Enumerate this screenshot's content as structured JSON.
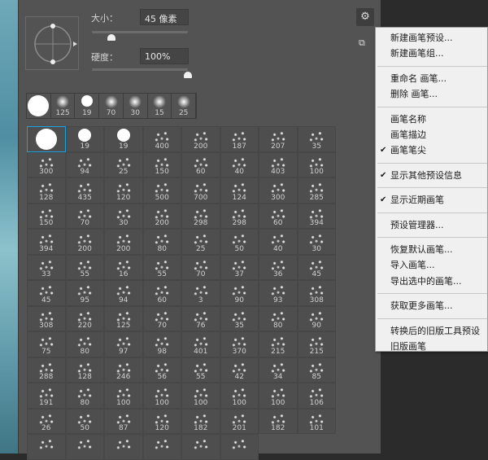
{
  "size": {
    "label": "大小：",
    "value": "45 像素",
    "slider_percent": 20
  },
  "hardness": {
    "label": "硬度：",
    "value": "100%",
    "slider_percent": 100
  },
  "recent": [
    {
      "n": "",
      "hard": true
    },
    {
      "n": "125"
    },
    {
      "n": "19",
      "hard": true
    },
    {
      "n": "70"
    },
    {
      "n": "30"
    },
    {
      "n": "15"
    },
    {
      "n": "25"
    }
  ],
  "presets": [
    "",
    "19",
    "19",
    "400",
    "200",
    "187",
    "207",
    "35",
    "300",
    "94",
    "25",
    "150",
    "60",
    "40",
    "403",
    "100",
    "128",
    "435",
    "120",
    "500",
    "700",
    "124",
    "300",
    "285",
    "150",
    "70",
    "30",
    "200",
    "298",
    "298",
    "60",
    "394",
    "394",
    "200",
    "200",
    "80",
    "25",
    "50",
    "40",
    "30",
    "33",
    "55",
    "16",
    "55",
    "70",
    "37",
    "36",
    "45",
    "45",
    "95",
    "94",
    "60",
    "3",
    "90",
    "93",
    "308",
    "308",
    "220",
    "125",
    "70",
    "76",
    "35",
    "80",
    "90",
    "75",
    "80",
    "97",
    "98",
    "401",
    "370",
    "215",
    "215",
    "288",
    "128",
    "246",
    "56",
    "55",
    "42",
    "34",
    "85",
    "191",
    "80",
    "100",
    "100",
    "100",
    "100",
    "100",
    "106",
    "26",
    "50",
    "87",
    "120",
    "182",
    "201",
    "182",
    "101",
    "",
    "",
    "",
    "",
    "",
    ""
  ],
  "gear_icon": "gear-icon",
  "menu": [
    {
      "label": "新建画笔预设...",
      "checked": false
    },
    {
      "label": "新建画笔组...",
      "checked": false
    },
    {
      "sep": true
    },
    {
      "label": "重命名 画笔...",
      "checked": false
    },
    {
      "label": "删除 画笔...",
      "checked": false
    },
    {
      "sep": true
    },
    {
      "label": "画笔名称",
      "checked": false
    },
    {
      "label": "画笔描边",
      "checked": false
    },
    {
      "label": "画笔笔尖",
      "checked": true
    },
    {
      "sep": true
    },
    {
      "label": "显示其他预设信息",
      "checked": true
    },
    {
      "sep": true
    },
    {
      "label": "显示近期画笔",
      "checked": true
    },
    {
      "sep": true
    },
    {
      "label": "预设管理器...",
      "checked": false
    },
    {
      "sep": true
    },
    {
      "label": "恢复默认画笔...",
      "checked": false
    },
    {
      "label": "导入画笔...",
      "checked": false
    },
    {
      "label": "导出选中的画笔...",
      "checked": false
    },
    {
      "sep": true
    },
    {
      "label": "获取更多画笔...",
      "checked": false
    },
    {
      "sep": true
    },
    {
      "label": "转换后的旧版工具预设",
      "checked": false
    },
    {
      "label": "旧版画笔",
      "checked": false
    }
  ],
  "check_mark": "✔"
}
